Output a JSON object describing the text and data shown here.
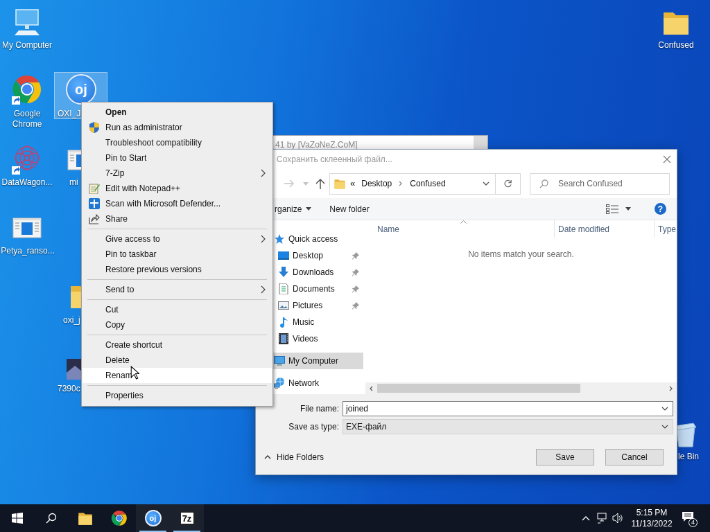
{
  "desktop_icons": [
    {
      "label": "My Computer",
      "selected": false
    },
    {
      "label": "Google Chrome",
      "selected": false
    },
    {
      "label": "OXI_J",
      "selected": true,
      "logo_text": "oj"
    },
    {
      "label": "DataWagon...",
      "selected": false
    },
    {
      "label": "mi",
      "selected": false
    },
    {
      "label": "Petya_ranso...",
      "selected": false
    },
    {
      "label": "oxi_j",
      "selected": false
    },
    {
      "label": "7390c",
      "selected": false
    },
    {
      "label": "Confused",
      "selected": false
    },
    {
      "label": "le Bin",
      "selected": false
    }
  ],
  "background_window": {
    "title": "41 by [VaZoNeZ.CoM]"
  },
  "save_dialog": {
    "title": "Сохранить склеенный файл...",
    "address_prefix": "«",
    "address": [
      "Desktop",
      "Confused"
    ],
    "search": {
      "placeholder": "Search Confused"
    },
    "toolbar": [
      {
        "label": "rganize",
        "dropdown": true
      },
      {
        "label": "New folder",
        "dropdown": false
      }
    ],
    "help": "?",
    "columns": [
      "Name",
      "Date modified",
      "Type"
    ],
    "empty_message": "No items match your search.",
    "nav_pane": [
      {
        "label": "Quick access",
        "selected": false,
        "pinned": false,
        "children": [
          {
            "label": "Desktop",
            "selected": false,
            "pinned": true
          },
          {
            "label": "Downloads",
            "selected": false,
            "pinned": true
          },
          {
            "label": "Documents",
            "selected": false,
            "pinned": true
          },
          {
            "label": "Pictures",
            "selected": false,
            "pinned": true
          },
          {
            "label": "Music",
            "selected": false,
            "pinned": false
          },
          {
            "label": "Videos",
            "selected": false,
            "pinned": false
          }
        ]
      },
      {
        "label": "My Computer",
        "selected": true,
        "pinned": false
      },
      {
        "label": "Network",
        "selected": false,
        "pinned": false
      }
    ],
    "file_name": {
      "label": "File name:",
      "value": "joined"
    },
    "save_as_type": {
      "label": "Save as type:",
      "value": "EXE-файл"
    },
    "hide_folders": "Hide Folders",
    "buttons": [
      "Save",
      "Cancel"
    ]
  },
  "context_menu": [
    {
      "kind": "item",
      "label": "Open",
      "default": true,
      "submenu": false,
      "hovered": false
    },
    {
      "kind": "item",
      "label": "Run as administrator",
      "default": false,
      "submenu": false,
      "hovered": false
    },
    {
      "kind": "item",
      "label": "Troubleshoot compatibility",
      "default": false,
      "submenu": false,
      "hovered": false
    },
    {
      "kind": "item",
      "label": "Pin to Start",
      "default": false,
      "submenu": false,
      "hovered": false
    },
    {
      "kind": "item",
      "label": "7-Zip",
      "default": false,
      "submenu": true,
      "hovered": false
    },
    {
      "kind": "item",
      "label": "Edit with Notepad++",
      "default": false,
      "submenu": false,
      "hovered": false
    },
    {
      "kind": "item",
      "label": "Scan with Microsoft Defender...",
      "default": false,
      "submenu": false,
      "hovered": false
    },
    {
      "kind": "item",
      "label": "Share",
      "default": false,
      "submenu": false,
      "hovered": false
    },
    {
      "kind": "separator"
    },
    {
      "kind": "item",
      "label": "Give access to",
      "default": false,
      "submenu": true,
      "hovered": false
    },
    {
      "kind": "item",
      "label": "Pin to taskbar",
      "default": false,
      "submenu": false,
      "hovered": false
    },
    {
      "kind": "item",
      "label": "Restore previous versions",
      "default": false,
      "submenu": false,
      "hovered": false
    },
    {
      "kind": "separator"
    },
    {
      "kind": "item",
      "label": "Send to",
      "default": false,
      "submenu": true,
      "hovered": false
    },
    {
      "kind": "separator"
    },
    {
      "kind": "item",
      "label": "Cut",
      "default": false,
      "submenu": false,
      "hovered": false
    },
    {
      "kind": "item",
      "label": "Copy",
      "default": false,
      "submenu": false,
      "hovered": false
    },
    {
      "kind": "separator"
    },
    {
      "kind": "item",
      "label": "Create shortcut",
      "default": false,
      "submenu": false,
      "hovered": false
    },
    {
      "kind": "item",
      "label": "Delete",
      "default": false,
      "submenu": false,
      "hovered": false
    },
    {
      "kind": "item",
      "label": "Renam",
      "default": false,
      "submenu": false,
      "hovered": true
    },
    {
      "kind": "separator"
    },
    {
      "kind": "item",
      "label": "Properties",
      "default": false,
      "submenu": false,
      "hovered": false
    }
  ],
  "taskbar": {
    "apps": [
      {
        "running": false
      },
      {
        "running": false
      },
      {
        "running": true,
        "logo_text": "oj"
      },
      {
        "running": true,
        "logo_text": "7z"
      }
    ],
    "time": "5:15 PM",
    "date": "11/13/2022",
    "notifications": "4"
  }
}
